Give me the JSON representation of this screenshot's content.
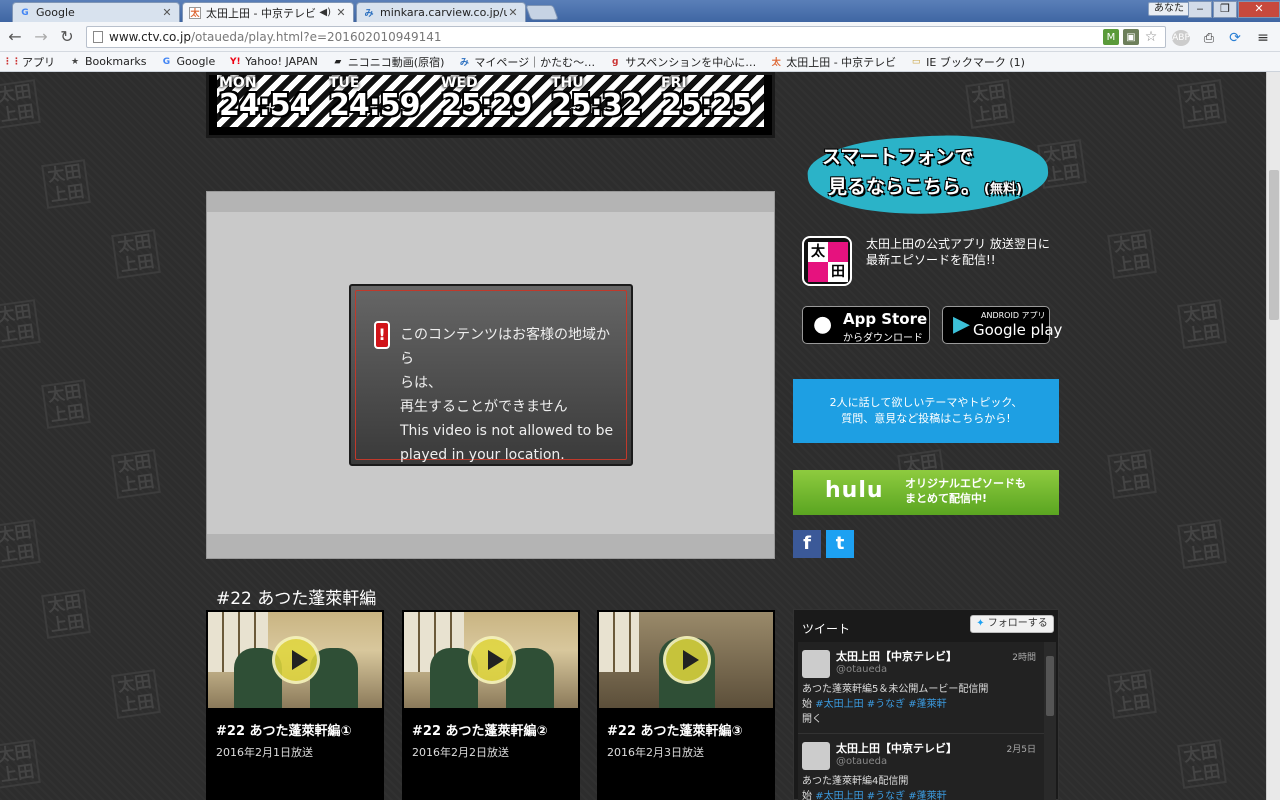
{
  "browser": {
    "tabs": [
      {
        "title": "Google",
        "favicon": "G"
      },
      {
        "title": "太田上田 - 中京テレビ",
        "favicon": "太"
      },
      {
        "title": "minkara.carview.co.jp/user/",
        "favicon": "み"
      }
    ],
    "user_badge": "あなた",
    "url_host": "www.ctv.co.jp",
    "url_path": "/otaueda/play.html?e=201602010949141",
    "bookmarks": [
      {
        "label": "アプリ",
        "icon": "apps-grid-icon"
      },
      {
        "label": "Bookmarks",
        "icon": "star-icon"
      },
      {
        "label": "Google",
        "icon": "google-icon"
      },
      {
        "label": "Yahoo! JAPAN",
        "icon": "yahoo-icon"
      },
      {
        "label": "ニコニコ動画(原宿)",
        "icon": "niconico-icon"
      },
      {
        "label": "マイページ｜かたむ〜…",
        "icon": "minkara-icon"
      },
      {
        "label": "サスペンションを中心に…",
        "icon": "goo-icon"
      },
      {
        "label": "太田上田 - 中京テレビ",
        "icon": "otaueda-icon"
      },
      {
        "label": "IE ブックマーク (1)",
        "icon": "folder-icon"
      }
    ]
  },
  "schedule": [
    {
      "dow": "MON",
      "time": "24:54"
    },
    {
      "dow": "TUE",
      "time": "24:59"
    },
    {
      "dow": "WED",
      "time": "25:29"
    },
    {
      "dow": "THU",
      "time": "25:32"
    },
    {
      "dow": "FRI",
      "time": "25:25"
    }
  ],
  "player": {
    "error_lines": [
      "このコンテンツはお客様の地域から",
      "らは、",
      "再生することができません",
      " This video is not allowed to be",
      "played in your location."
    ]
  },
  "episode": {
    "heading": "#22 あつた蓬萊軒編",
    "cards": [
      {
        "title": "#22 あつた蓬萊軒編①",
        "date": "2016年2月1日放送"
      },
      {
        "title": "#22 あつた蓬萊軒編②",
        "date": "2016年2月2日放送"
      },
      {
        "title": "#22 あつた蓬萊軒編③",
        "date": "2016年2月3日放送"
      }
    ]
  },
  "sidebar": {
    "sp_line1": "スマートフォンで",
    "sp_line2": "見るならこちら。",
    "sp_free": "(無料)",
    "app_icon_chars": [
      "太",
      "田"
    ],
    "app_desc": "太田上田の公式アプリ 放送翌日に最新エピソードを配信!!",
    "appstore_l1": "App Store",
    "appstore_l2": "からダウンロード",
    "gplay_l1": "ANDROID アプリ",
    "gplay_l2": "Google play",
    "topic_l1": "2人に話して欲しいテーマやトピック、",
    "topic_l2": "質問、意見など投稿はこちらから!",
    "hulu_logo": "hulu",
    "hulu_l1": "オリジナルエピソードも",
    "hulu_l2": "まとめて配信中!",
    "fb": "f",
    "tw": "t"
  },
  "tweets": {
    "header": "ツイート",
    "follow": "フォローする",
    "items": [
      {
        "name": "太田上田【中京テレビ】",
        "handle": "@otaueda",
        "time": "2時間",
        "text": "あつた蓬萊軒編5＆未公開ムービー配信開",
        "line2": "始",
        "tags": "#太田上田 #うなぎ #蓬萊軒",
        "line3": "開く"
      },
      {
        "name": "太田上田【中京テレビ】",
        "handle": "@otaueda",
        "time": "2月5日",
        "text": "あつた蓬萊軒編4配信開",
        "line2": "始",
        "tags": "#太田上田 #うなぎ #蓬萊軒",
        "line3": ""
      }
    ]
  },
  "colors": {
    "accent_blue": "#1e9fe3",
    "hulu_green": "#6cb42c",
    "error_red": "#d1141a"
  }
}
